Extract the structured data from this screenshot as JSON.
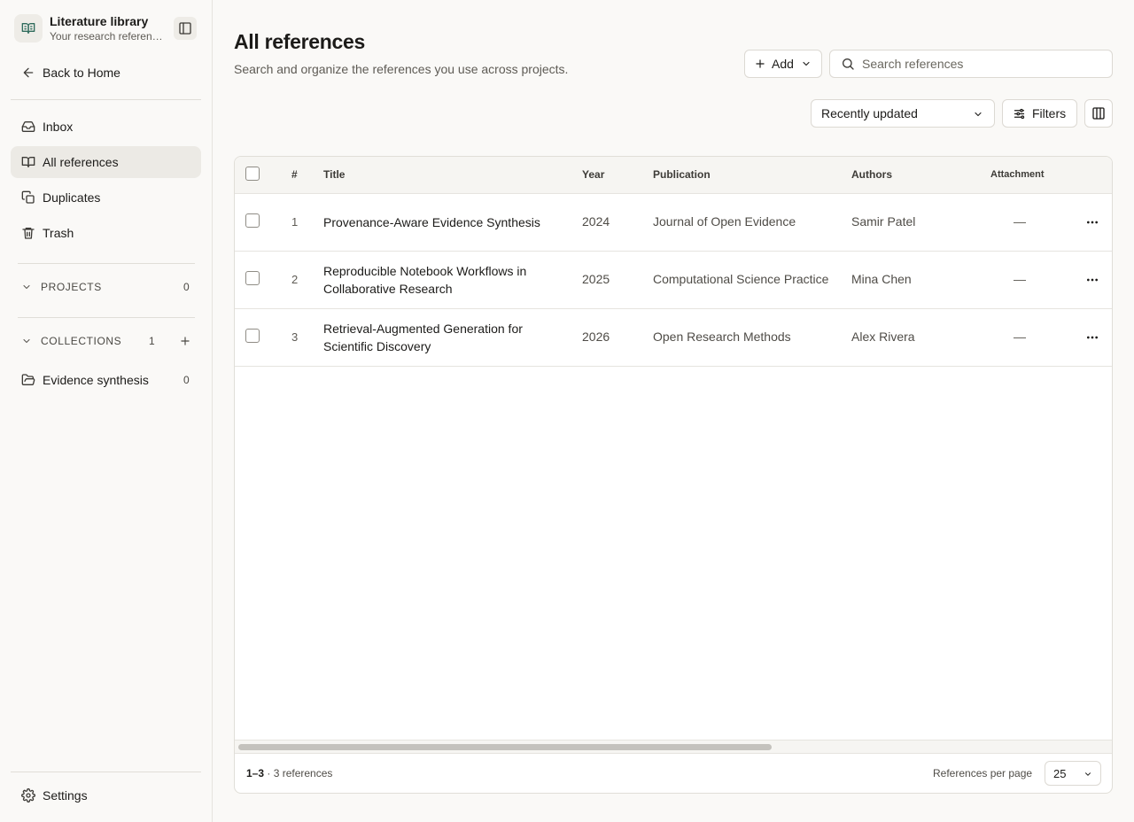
{
  "sidebar": {
    "brand": {
      "title": "Literature library",
      "subtitle": "Your research references"
    },
    "back": "Back to Home",
    "nav": [
      {
        "label": "Inbox",
        "icon": "inbox-icon",
        "active": false
      },
      {
        "label": "All references",
        "icon": "book-open-icon",
        "active": true
      },
      {
        "label": "Duplicates",
        "icon": "copy-icon",
        "active": false
      },
      {
        "label": "Trash",
        "icon": "trash-icon",
        "active": false
      }
    ],
    "projects": {
      "label": "PROJECTS",
      "count": "0"
    },
    "collections": {
      "label": "COLLECTIONS",
      "count": "1",
      "items": [
        {
          "label": "Evidence synthesis",
          "count": "0",
          "icon": "folder-open-icon"
        }
      ]
    },
    "settings": "Settings"
  },
  "header": {
    "title": "All references",
    "subtitle": "Search and organize the references you use across projects.",
    "add_label": "Add",
    "search_placeholder": "Search references",
    "sort_label": "Recently updated",
    "filters_label": "Filters"
  },
  "table": {
    "columns": {
      "num": "#",
      "title": "Title",
      "year": "Year",
      "publication": "Publication",
      "authors": "Authors",
      "attachment": "Attachment"
    },
    "rows": [
      {
        "num": "1",
        "title": "Provenance-Aware Evidence Synthesis",
        "year": "2024",
        "publication": "Journal of Open Evidence",
        "authors": "Samir Patel",
        "attachment": "—"
      },
      {
        "num": "2",
        "title": "Reproducible Notebook Workflows in Collaborative Research",
        "year": "2025",
        "publication": "Computational Science Practice",
        "authors": "Mina Chen",
        "attachment": "—"
      },
      {
        "num": "3",
        "title": "Retrieval-Augmented Generation for Scientific Discovery",
        "year": "2026",
        "publication": "Open Research Methods",
        "authors": "Alex Rivera",
        "attachment": "—"
      }
    ],
    "footer": {
      "range": "1–3",
      "count_text": "· 3 references",
      "per_page_label": "References per page",
      "per_page": "25"
    }
  },
  "colors": {
    "accent": "#2f6b5c",
    "active_bg": "#eceae5",
    "page_bg": "#faf9f7"
  }
}
